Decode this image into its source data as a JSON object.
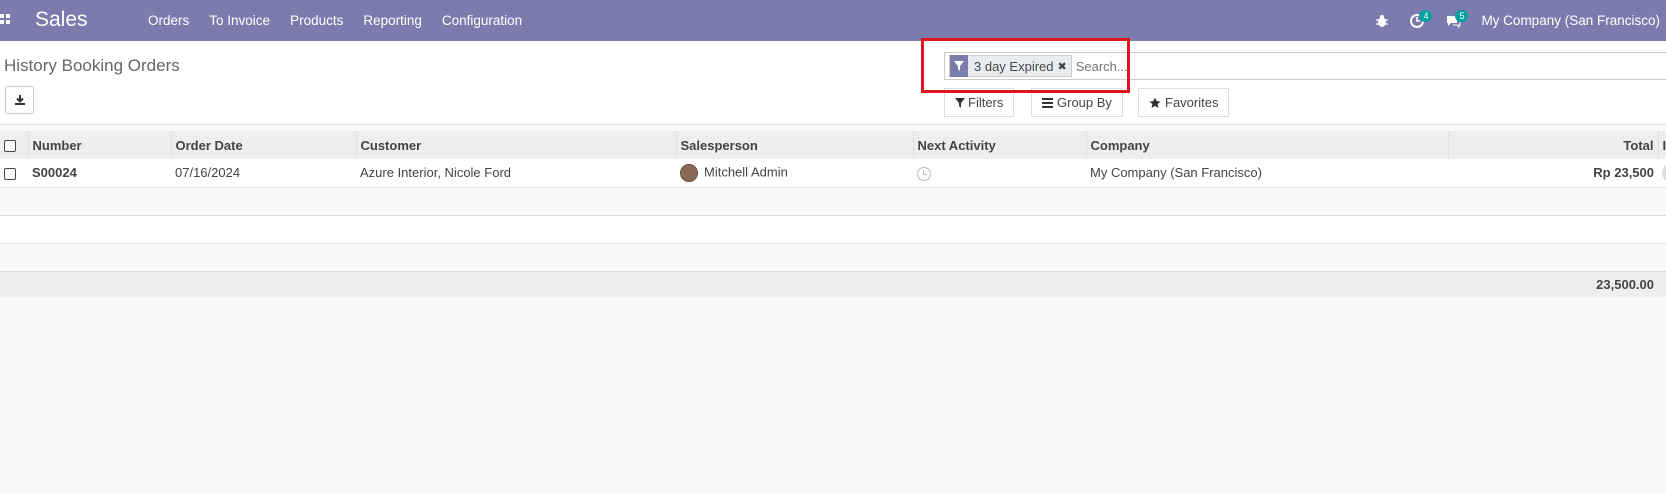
{
  "navbar": {
    "app_name": "Sales",
    "menu": [
      "Orders",
      "To Invoice",
      "Products",
      "Reporting",
      "Configuration"
    ],
    "activity_count": "4",
    "message_count": "5",
    "company": "My Company (San Francisco)"
  },
  "control_panel": {
    "title": "History Booking Orders",
    "facet": "3 day Expired",
    "search_placeholder": "Search...",
    "filters_label": "Filters",
    "group_by_label": "Group By",
    "favorites_label": "Favorites"
  },
  "table": {
    "headers": [
      "Number",
      "Order Date",
      "Customer",
      "Salesperson",
      "Next Activity",
      "Company",
      "Total",
      "I"
    ],
    "rows": [
      {
        "number": "S00024",
        "order_date": "07/16/2024",
        "customer": "Azure Interior, Nicole Ford",
        "salesperson": "Mitchell Admin",
        "company": "My Company (San Francisco)",
        "total": "Rp 23,500"
      }
    ],
    "footer_total": "23,500.00"
  },
  "colors": {
    "navbar": "#7c7bad",
    "highlight": "#e0151f",
    "badge": "#00a09d"
  }
}
